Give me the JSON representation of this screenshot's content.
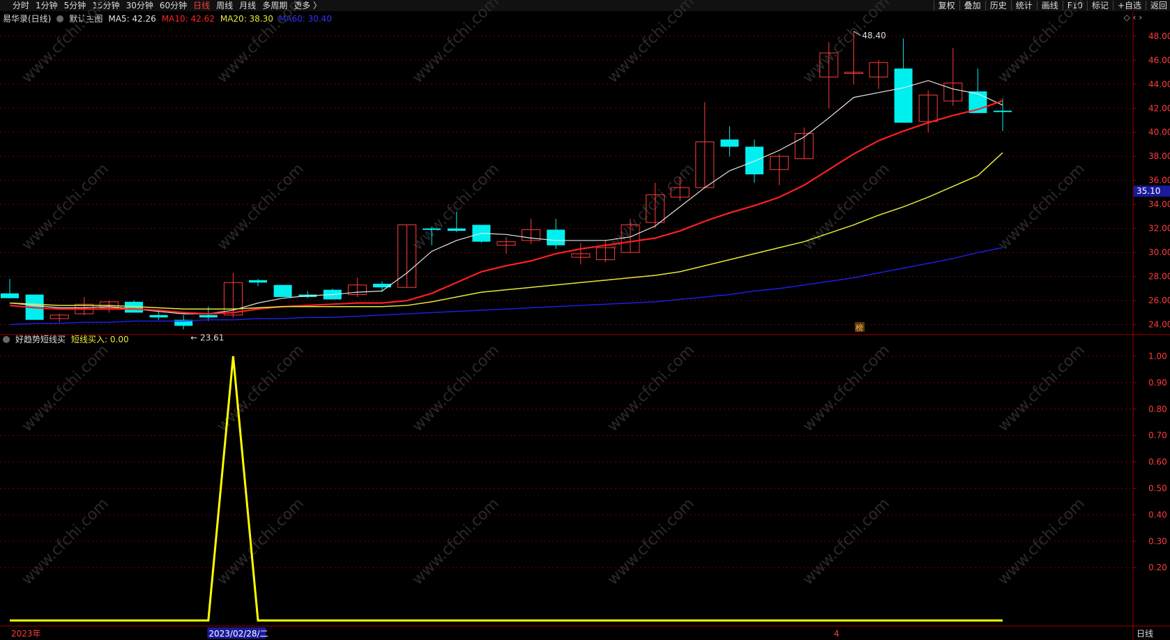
{
  "toolbar": {
    "periods": [
      "分时",
      "1分钟",
      "5分钟",
      "15分钟",
      "30分钟",
      "60分钟",
      "日线",
      "周线",
      "月线",
      "多周期",
      "更多 〉"
    ],
    "active_period": "日线",
    "tools": [
      "复权",
      "叠加",
      "历史",
      "统计",
      "画线",
      "F10",
      "标记",
      "+自选",
      "返回"
    ]
  },
  "info": {
    "stock": "易华录(日线)",
    "template": "默认主图",
    "ma5": "MA5: 42.26",
    "ma10": "MA10: 42.62",
    "ma20": "MA20: 38.30",
    "ma60": "MA60: 30.40"
  },
  "indicator": {
    "name": "好趋势短线买",
    "value": "短线买入: 0.00"
  },
  "price_axis": [
    "48.00",
    "46.00",
    "44.00",
    "42.00",
    "40.00",
    "38.00",
    "36.00",
    "34.00",
    "32.00",
    "30.00",
    "28.00",
    "26.00",
    "24.00"
  ],
  "current_price": "35.10",
  "indicator_axis": [
    "1.00",
    "0.90",
    "0.80",
    "0.70",
    "0.60",
    "0.50",
    "0.40",
    "0.30",
    "0.20"
  ],
  "high_marker": "48.40",
  "low_marker": "23.61",
  "event_marker": "榜",
  "date_axis": {
    "year": "2023年",
    "selected": "2023/02/28/二",
    "month": "4"
  },
  "bottom_button": "日线",
  "watermark": "www.cfchi.com",
  "colors": {
    "up": "#ff3c3c",
    "down": "#00f0f0",
    "ma5": "#e6e6e6",
    "ma10": "#ff2020",
    "ma20": "#e8e83c",
    "ma60": "#1e1ee6",
    "grid": "#7a0000"
  },
  "chart_data": [
    {
      "type": "candlestick",
      "title": "",
      "candles": [
        {
          "o": 26.6,
          "h": 27.8,
          "l": 26.2,
          "c": 26.2
        },
        {
          "o": 26.5,
          "h": 26.5,
          "l": 24.4,
          "c": 24.4
        },
        {
          "o": 24.5,
          "h": 24.9,
          "l": 24.2,
          "c": 24.8
        },
        {
          "o": 24.9,
          "h": 26.3,
          "l": 24.8,
          "c": 25.7
        },
        {
          "o": 25.4,
          "h": 26.0,
          "l": 25.0,
          "c": 25.9
        },
        {
          "o": 25.9,
          "h": 26.0,
          "l": 25.0,
          "c": 25.0
        },
        {
          "o": 24.8,
          "h": 25.2,
          "l": 24.4,
          "c": 24.6
        },
        {
          "o": 24.4,
          "h": 24.8,
          "l": 23.61,
          "c": 23.9
        },
        {
          "o": 24.8,
          "h": 25.5,
          "l": 24.3,
          "c": 24.6
        },
        {
          "o": 24.8,
          "h": 28.3,
          "l": 24.6,
          "c": 27.5
        },
        {
          "o": 27.7,
          "h": 27.8,
          "l": 27.2,
          "c": 27.5
        },
        {
          "o": 27.3,
          "h": 27.3,
          "l": 26.3,
          "c": 26.3
        },
        {
          "o": 26.5,
          "h": 26.8,
          "l": 26.2,
          "c": 26.3
        },
        {
          "o": 26.9,
          "h": 27.0,
          "l": 26.1,
          "c": 26.1
        },
        {
          "o": 26.5,
          "h": 27.9,
          "l": 26.3,
          "c": 27.3
        },
        {
          "o": 27.4,
          "h": 27.6,
          "l": 26.7,
          "c": 27.1
        },
        {
          "o": 27.1,
          "h": 32.3,
          "l": 27.1,
          "c": 32.3
        },
        {
          "o": 32.0,
          "h": 32.1,
          "l": 30.6,
          "c": 31.9
        },
        {
          "o": 32.0,
          "h": 33.4,
          "l": 31.7,
          "c": 31.8
        },
        {
          "o": 32.3,
          "h": 32.3,
          "l": 30.8,
          "c": 30.9
        },
        {
          "o": 30.6,
          "h": 31.3,
          "l": 29.9,
          "c": 30.9
        },
        {
          "o": 31.0,
          "h": 32.8,
          "l": 30.7,
          "c": 31.9
        },
        {
          "o": 31.9,
          "h": 32.8,
          "l": 30.3,
          "c": 30.6
        },
        {
          "o": 29.6,
          "h": 30.8,
          "l": 29.0,
          "c": 29.9
        },
        {
          "o": 29.4,
          "h": 31.0,
          "l": 29.2,
          "c": 30.4
        },
        {
          "o": 30.0,
          "h": 32.8,
          "l": 30.0,
          "c": 32.3
        },
        {
          "o": 32.5,
          "h": 35.8,
          "l": 32.0,
          "c": 34.8
        },
        {
          "o": 34.6,
          "h": 36.3,
          "l": 34.3,
          "c": 35.4
        },
        {
          "o": 35.4,
          "h": 42.5,
          "l": 35.4,
          "c": 39.2
        },
        {
          "o": 39.4,
          "h": 40.5,
          "l": 38.0,
          "c": 38.8
        },
        {
          "o": 38.8,
          "h": 39.4,
          "l": 35.8,
          "c": 36.5
        },
        {
          "o": 36.9,
          "h": 38.2,
          "l": 35.6,
          "c": 38.0
        },
        {
          "o": 37.8,
          "h": 40.4,
          "l": 37.8,
          "c": 39.9
        },
        {
          "o": 44.6,
          "h": 47.5,
          "l": 42.0,
          "c": 46.6
        },
        {
          "o": 45.0,
          "h": 48.4,
          "l": 44.0,
          "c": 45.0
        },
        {
          "o": 44.6,
          "h": 46.0,
          "l": 43.6,
          "c": 45.8
        },
        {
          "o": 45.3,
          "h": 47.8,
          "l": 40.8,
          "c": 40.8
        },
        {
          "o": 40.9,
          "h": 43.5,
          "l": 40.0,
          "c": 43.1
        },
        {
          "o": 42.6,
          "h": 47.0,
          "l": 42.2,
          "c": 44.1
        },
        {
          "o": 43.4,
          "h": 45.3,
          "l": 41.6,
          "c": 41.6
        },
        {
          "o": 41.8,
          "h": 42.8,
          "l": 40.1,
          "c": 41.7
        }
      ],
      "series": [
        {
          "name": "MA5",
          "values": [
            25.8,
            25.6,
            25.4,
            25.4,
            25.5,
            25.3,
            25.1,
            24.9,
            24.9,
            25.2,
            25.8,
            26.2,
            26.4,
            26.5,
            26.7,
            26.8,
            28.3,
            30.1,
            31.0,
            31.6,
            31.5,
            31.2,
            31.0,
            31.0,
            31.0,
            31.3,
            32.2,
            33.8,
            35.4,
            36.8,
            37.6,
            38.5,
            39.6,
            41.2,
            42.9,
            43.3,
            43.7,
            44.3,
            43.6,
            43.2,
            42.26
          ]
        },
        {
          "name": "MA10",
          "values": [
            25.6,
            25.4,
            25.3,
            25.3,
            25.3,
            25.3,
            25.2,
            25.0,
            24.9,
            25.0,
            25.3,
            25.5,
            25.6,
            25.7,
            25.8,
            25.8,
            26.0,
            26.6,
            27.5,
            28.4,
            28.9,
            29.3,
            29.9,
            30.3,
            30.6,
            30.9,
            31.2,
            31.8,
            32.6,
            33.3,
            33.9,
            34.6,
            35.6,
            36.9,
            38.2,
            39.3,
            40.1,
            40.8,
            41.4,
            41.9,
            42.62
          ]
        },
        {
          "name": "MA20",
          "values": [
            25.8,
            25.7,
            25.6,
            25.6,
            25.6,
            25.5,
            25.4,
            25.3,
            25.3,
            25.3,
            25.4,
            25.5,
            25.5,
            25.5,
            25.5,
            25.5,
            25.6,
            25.9,
            26.3,
            26.7,
            26.9,
            27.1,
            27.3,
            27.5,
            27.7,
            27.9,
            28.1,
            28.4,
            28.9,
            29.4,
            29.9,
            30.4,
            30.9,
            31.6,
            32.3,
            33.1,
            33.8,
            34.6,
            35.5,
            36.4,
            38.3
          ]
        },
        {
          "name": "MA60",
          "values": [
            24.0,
            24.1,
            24.1,
            24.2,
            24.2,
            24.3,
            24.3,
            24.3,
            24.4,
            24.4,
            24.5,
            24.5,
            24.6,
            24.6,
            24.7,
            24.8,
            24.9,
            25.0,
            25.1,
            25.2,
            25.3,
            25.4,
            25.5,
            25.6,
            25.7,
            25.8,
            25.9,
            26.1,
            26.3,
            26.5,
            26.8,
            27.0,
            27.3,
            27.6,
            27.9,
            28.3,
            28.7,
            29.1,
            29.5,
            30.0,
            30.4
          ]
        }
      ],
      "ylim": [
        23.4,
        48.8
      ]
    },
    {
      "type": "line",
      "title": "",
      "series": [
        {
          "name": "短线买入",
          "values": [
            0,
            0,
            0,
            0,
            0,
            0,
            0,
            0,
            0,
            1,
            0,
            0,
            0,
            0,
            0,
            0,
            0,
            0,
            0,
            0,
            0,
            0,
            0,
            0,
            0,
            0,
            0,
            0,
            0,
            0,
            0,
            0,
            0,
            0,
            0,
            0,
            0,
            0,
            0,
            0,
            0
          ]
        }
      ],
      "ylim": [
        0,
        1.05
      ]
    }
  ]
}
